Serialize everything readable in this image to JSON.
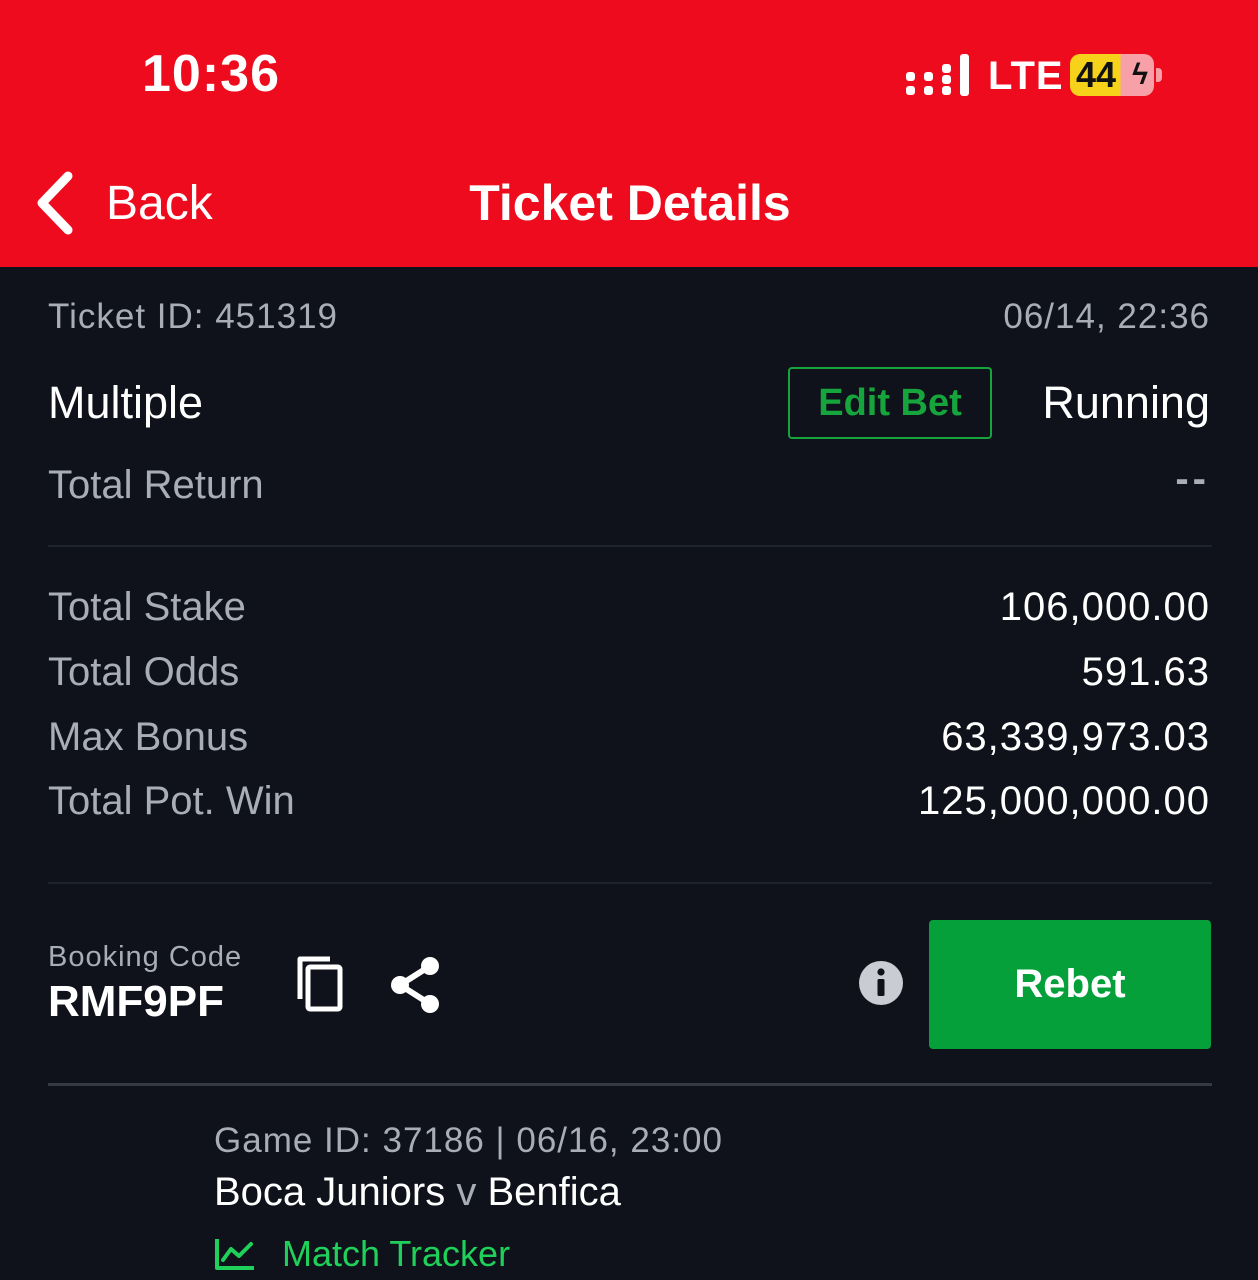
{
  "status_bar": {
    "time": "10:36",
    "network": "LTE",
    "battery": "44"
  },
  "header": {
    "back_label": "Back",
    "title": "Ticket Details"
  },
  "ticket": {
    "id_text": "Ticket ID: 451319",
    "datetime": "06/14, 22:36",
    "bet_type": "Multiple",
    "edit_bet_label": "Edit Bet",
    "status": "Running",
    "total_return_label": "Total Return",
    "total_return_value": "--"
  },
  "stats": [
    {
      "label": "Total Stake",
      "value": "106,000.00"
    },
    {
      "label": "Total Odds",
      "value": "591.63"
    },
    {
      "label": "Max Bonus",
      "value": "63,339,973.03"
    },
    {
      "label": "Total Pot. Win",
      "value": "125,000,000.00"
    }
  ],
  "booking": {
    "label": "Booking Code",
    "code": "RMF9PF",
    "rebet_label": "Rebet"
  },
  "game": {
    "meta": "Game ID: 37186 | 06/16, 23:00",
    "home": "Boca Juniors",
    "vs": "v",
    "away": "Benfica",
    "tracker_label": "Match Tracker"
  },
  "colors": {
    "header_red": "#ee0b1d",
    "background": "#0f121a",
    "accent_green": "#05a03a",
    "tracker_green": "#1fd15a"
  },
  "icons": [
    "back-chevron-icon",
    "signal-icon",
    "battery-icon",
    "copy-icon",
    "share-icon",
    "info-icon",
    "chart-icon"
  ]
}
